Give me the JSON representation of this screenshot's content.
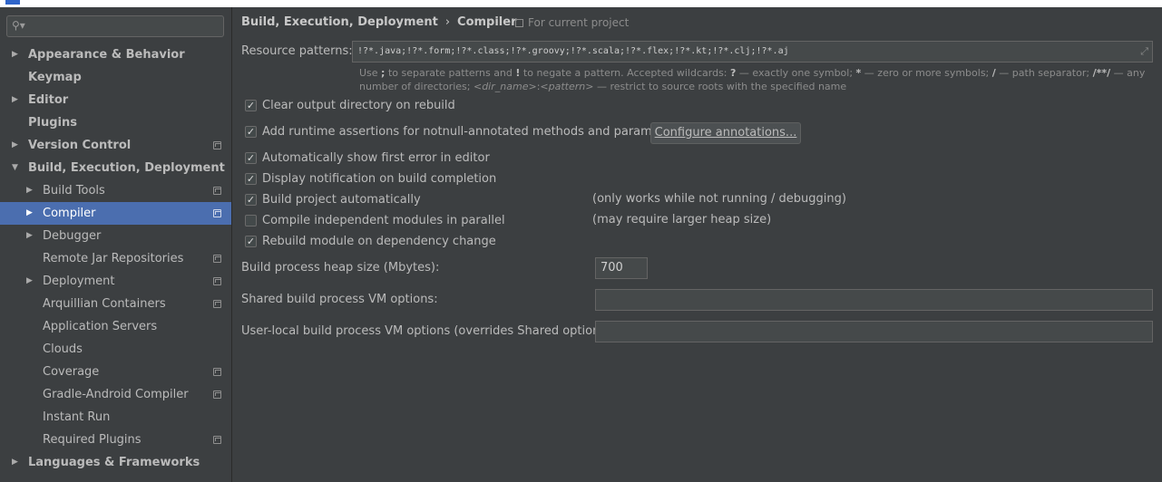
{
  "sidebar": {
    "search_icon": "search-icon",
    "items": [
      {
        "label": "Appearance & Behavior",
        "expandable": true,
        "expanded": false,
        "level": 0,
        "bold": true,
        "project": false,
        "selected": false
      },
      {
        "label": "Keymap",
        "expandable": false,
        "level": 0,
        "bold": true,
        "project": false,
        "selected": false
      },
      {
        "label": "Editor",
        "expandable": true,
        "expanded": false,
        "level": 0,
        "bold": true,
        "project": false,
        "selected": false
      },
      {
        "label": "Plugins",
        "expandable": false,
        "level": 0,
        "bold": true,
        "project": false,
        "selected": false
      },
      {
        "label": "Version Control",
        "expandable": true,
        "expanded": false,
        "level": 0,
        "bold": true,
        "project": true,
        "selected": false
      },
      {
        "label": "Build, Execution, Deployment",
        "expandable": true,
        "expanded": true,
        "level": 0,
        "bold": true,
        "project": false,
        "selected": false
      },
      {
        "label": "Build Tools",
        "expandable": true,
        "expanded": false,
        "level": 1,
        "bold": false,
        "project": true,
        "selected": false
      },
      {
        "label": "Compiler",
        "expandable": true,
        "expanded": false,
        "level": 1,
        "bold": false,
        "project": true,
        "selected": true
      },
      {
        "label": "Debugger",
        "expandable": true,
        "expanded": false,
        "level": 1,
        "bold": false,
        "project": false,
        "selected": false
      },
      {
        "label": "Remote Jar Repositories",
        "expandable": false,
        "level": 1,
        "bold": false,
        "project": true,
        "selected": false
      },
      {
        "label": "Deployment",
        "expandable": true,
        "expanded": false,
        "level": 1,
        "bold": false,
        "project": true,
        "selected": false
      },
      {
        "label": "Arquillian Containers",
        "expandable": false,
        "level": 1,
        "bold": false,
        "project": true,
        "selected": false
      },
      {
        "label": "Application Servers",
        "expandable": false,
        "level": 1,
        "bold": false,
        "project": false,
        "selected": false
      },
      {
        "label": "Clouds",
        "expandable": false,
        "level": 1,
        "bold": false,
        "project": false,
        "selected": false
      },
      {
        "label": "Coverage",
        "expandable": false,
        "level": 1,
        "bold": false,
        "project": true,
        "selected": false
      },
      {
        "label": "Gradle-Android Compiler",
        "expandable": false,
        "level": 1,
        "bold": false,
        "project": true,
        "selected": false
      },
      {
        "label": "Instant Run",
        "expandable": false,
        "level": 1,
        "bold": false,
        "project": false,
        "selected": false
      },
      {
        "label": "Required Plugins",
        "expandable": false,
        "level": 1,
        "bold": false,
        "project": true,
        "selected": false
      },
      {
        "label": "Languages & Frameworks",
        "expandable": true,
        "expanded": false,
        "level": 0,
        "bold": true,
        "project": false,
        "selected": false
      }
    ]
  },
  "breadcrumb": {
    "parent": "Build, Execution, Deployment",
    "separator": "›",
    "current": "Compiler",
    "scope_label": "For current project"
  },
  "resource_patterns": {
    "label": "Resource patterns:",
    "value": "!?*.java;!?*.form;!?*.class;!?*.groovy;!?*.scala;!?*.flex;!?*.kt;!?*.clj;!?*.aj",
    "hint": {
      "p1": "Use ",
      "s1": ";",
      "p2": " to separate patterns and ",
      "s2": "!",
      "p3": " to negate a pattern. Accepted wildcards: ",
      "s3": "?",
      "p4": " — exactly one symbol; ",
      "s4": "*",
      "p5": " — zero or more symbols; ",
      "s5": "/",
      "p6": " — path separator; ",
      "s6": "/**/",
      "p7": " — any number of directories; ",
      "i1": "<dir_name>",
      "p8": ":",
      "i2": "<pattern>",
      "p9": " — restrict to source roots with the specified name"
    }
  },
  "options": [
    {
      "label": "Clear output directory on rebuild",
      "checked": true,
      "note": ""
    },
    {
      "label": "Add runtime assertions for notnull-annotated methods and parameters",
      "checked": true,
      "note": ""
    },
    {
      "label": "Automatically show first error in editor",
      "checked": true,
      "note": ""
    },
    {
      "label": "Display notification on build completion",
      "checked": true,
      "note": ""
    },
    {
      "label": "Build project automatically",
      "checked": true,
      "note": "(only works while not running / debugging)"
    },
    {
      "label": "Compile independent modules in parallel",
      "checked": false,
      "note": "(may require larger heap size)"
    },
    {
      "label": "Rebuild module on dependency change",
      "checked": true,
      "note": ""
    }
  ],
  "configure_button": "Configure annotations...",
  "heap": {
    "label": "Build process heap size (Mbytes):",
    "value": "700"
  },
  "shared_vm": {
    "label": "Shared build process VM options:",
    "value": ""
  },
  "user_vm": {
    "label": "User-local build process VM options (overrides Shared options):",
    "value": ""
  },
  "check_glyph": "✓",
  "arrow_right": "▶",
  "arrow_down": "▼"
}
